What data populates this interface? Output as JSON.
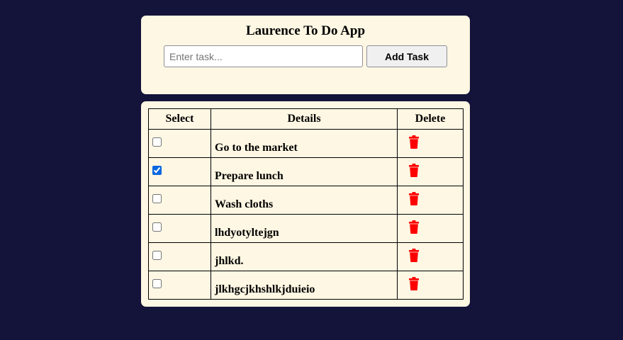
{
  "header": {
    "title": "Laurence To Do App",
    "input_placeholder": "Enter task...",
    "input_value": "",
    "add_button_label": "Add Task"
  },
  "table": {
    "columns": [
      "Select",
      "Details",
      "Delete"
    ],
    "rows": [
      {
        "details": "Go to the market",
        "checked": false
      },
      {
        "details": "Prepare lunch",
        "checked": true
      },
      {
        "details": "Wash cloths",
        "checked": false
      },
      {
        "details": "lhdyotyltejgn",
        "checked": false
      },
      {
        "details": "jhlkd.",
        "checked": false
      },
      {
        "details": "jlkhgcjkhshlkjduieio",
        "checked": false
      }
    ]
  },
  "colors": {
    "background": "#14133a",
    "card": "#fef7e3",
    "delete_icon": "#ff0000",
    "checkbox_accent": "#0b67e0"
  },
  "icons": {
    "delete": "trash-icon"
  }
}
